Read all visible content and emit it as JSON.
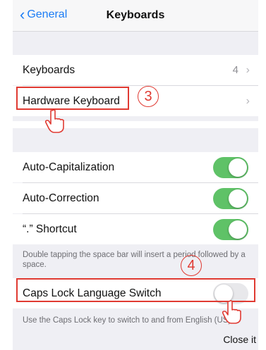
{
  "nav": {
    "back_label": "General",
    "title": "Keyboards"
  },
  "rows": {
    "keyboards": {
      "label": "Keyboards",
      "value": "4"
    },
    "hardware": {
      "label": "Hardware Keyboard"
    },
    "auto_cap": {
      "label": "Auto-Capitalization",
      "state": "on"
    },
    "auto_correct": {
      "label": "Auto-Correction",
      "state": "on"
    },
    "shortcut": {
      "label": "“.” Shortcut",
      "state": "on"
    },
    "caps_lock": {
      "label": "Caps Lock Language Switch",
      "state": "off"
    }
  },
  "footnotes": {
    "shortcut": "Double tapping the space bar will insert a period followed by a space.",
    "caps_lock": "Use the Caps Lock key to switch to and from English (US)"
  },
  "annotations": {
    "step3": "3",
    "step4": "4",
    "close_note": "Close it"
  },
  "colors": {
    "accent": "#1a7cf5",
    "toggle_on": "#5fc267",
    "annotation": "#e03a32"
  }
}
